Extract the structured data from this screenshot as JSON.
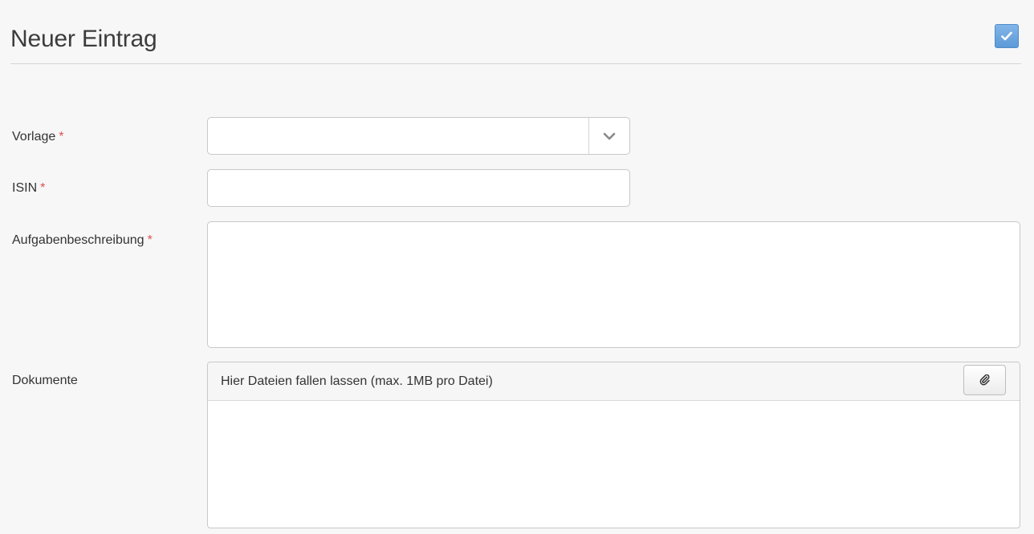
{
  "header": {
    "title": "Neuer Eintrag",
    "save_icon": "check-icon"
  },
  "form": {
    "vorlage": {
      "label": "Vorlage",
      "required_mark": "*",
      "value": "",
      "toggle_icon": "chevron-down-icon"
    },
    "isin": {
      "label": "ISIN",
      "required_mark": "*",
      "value": ""
    },
    "aufgabenbeschreibung": {
      "label": "Aufgabenbeschreibung",
      "required_mark": "*",
      "value": ""
    },
    "dokumente": {
      "label": "Dokumente",
      "dropzone_text": "Hier Dateien fallen lassen (max. 1MB pro Datei)",
      "attach_icon": "paperclip-icon"
    }
  },
  "colors": {
    "accent": "#5c9ad8",
    "required": "#d9534f",
    "background": "#f7f7f7"
  }
}
